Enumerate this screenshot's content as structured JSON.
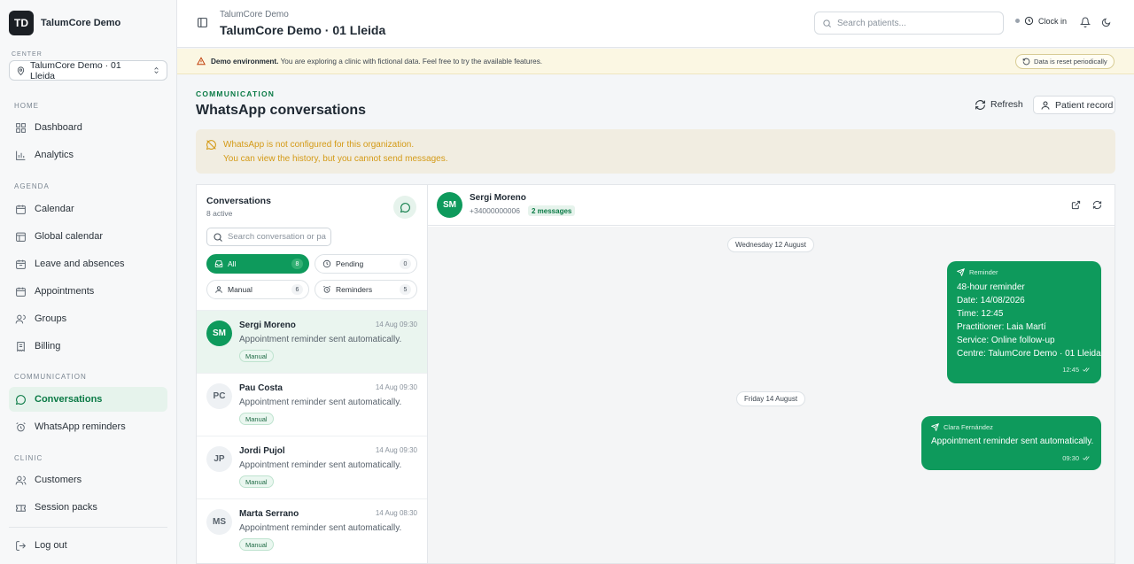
{
  "brand": {
    "initials": "TD",
    "name": "TalumCore Demo"
  },
  "center": {
    "label": "CENTER",
    "value": "TalumCore Demo · 01 Lleida"
  },
  "nav": {
    "home": "HOME",
    "dashboard": "Dashboard",
    "analytics": "Analytics",
    "agenda": "AGENDA",
    "calendar": "Calendar",
    "global_calendar": "Global calendar",
    "leave": "Leave and absences",
    "appointments": "Appointments",
    "groups": "Groups",
    "billing": "Billing",
    "communication": "COMMUNICATION",
    "conversations": "Conversations",
    "wa_reminders": "WhatsApp reminders",
    "clinic": "CLINIC",
    "customers": "Customers",
    "session_packs": "Session packs",
    "logout": "Log out"
  },
  "header": {
    "crumb": "TalumCore Demo",
    "title": "TalumCore Demo · 01 Lleida",
    "search_placeholder": "Search patients...",
    "clock_in": "Clock in"
  },
  "demo_banner": {
    "bold": "Demo environment.",
    "text": " You are exploring a clinic with fictional data. Feel free to try the available features.",
    "reset": "Data is reset periodically"
  },
  "page": {
    "eyebrow": "COMMUNICATION",
    "title": "WhatsApp conversations",
    "refresh": "Refresh",
    "patient_record": "Patient record"
  },
  "wa_warning": {
    "line1": "WhatsApp is not configured for this organization.",
    "line2": "You can view the history, but you cannot send messages."
  },
  "conversations": {
    "title": "Conversations",
    "subtitle": "8 active",
    "search_placeholder": "Search conversation or pa",
    "filters": [
      {
        "label": "All",
        "count": "8"
      },
      {
        "label": "Pending",
        "count": "0"
      },
      {
        "label": "Manual",
        "count": "6"
      },
      {
        "label": "Reminders",
        "count": "5"
      }
    ],
    "items": [
      {
        "initials": "SM",
        "name": "Sergi Moreno",
        "time": "14 Aug 09:30",
        "message": "Appointment reminder sent automatically.",
        "tag": "Manual"
      },
      {
        "initials": "PC",
        "name": "Pau Costa",
        "time": "14 Aug 09:30",
        "message": "Appointment reminder sent automatically.",
        "tag": "Manual"
      },
      {
        "initials": "JP",
        "name": "Jordi Pujol",
        "time": "14 Aug 09:30",
        "message": "Appointment reminder sent automatically.",
        "tag": "Manual"
      },
      {
        "initials": "MS",
        "name": "Marta Serrano",
        "time": "14 Aug 08:30",
        "message": "Appointment reminder sent automatically.",
        "tag": "Manual"
      }
    ]
  },
  "chat": {
    "initials": "SM",
    "name": "Sergi Moreno",
    "phone": "+34000000006",
    "count": "2 messages",
    "dates": [
      "Wednesday 12 August",
      "Friday 14 August"
    ],
    "msg1": {
      "sender": "Reminder",
      "lines": [
        "48-hour reminder",
        "Date: 14/08/2026",
        "Time: 12:45",
        "Practitioner: Laia Martí",
        "Service: Online follow-up",
        "Centre: TalumCore Demo · 01 Lleida"
      ],
      "time": "12:45"
    },
    "msg2": {
      "sender": "Clara Fernández",
      "text": "Appointment reminder sent automatically.",
      "time": "09:30"
    }
  },
  "colors": {
    "accent": "#0e9a5c",
    "warning_text": "#d49a16",
    "banner_bg": "#fbf7e3"
  }
}
